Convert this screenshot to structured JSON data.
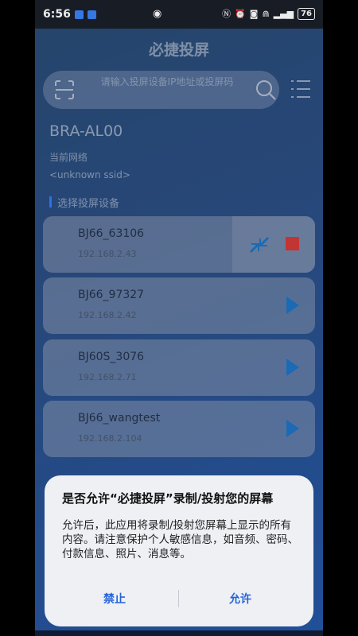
{
  "status_bar": {
    "time": "6:56",
    "battery": "76"
  },
  "app": {
    "title": "必捷投屏",
    "search_placeholder": "请输入投屏设备IP地址或投屏码",
    "device_name": "BRA-AL00",
    "network_label": "当前网络",
    "ssid": "<unknown ssid>",
    "section_label": "选择投屏设备"
  },
  "devices": [
    {
      "name": "BJ66_63106",
      "ip": "192.168.2.43",
      "state": "casting"
    },
    {
      "name": "BJ66_97327",
      "ip": "192.168.2.42",
      "state": "idle"
    },
    {
      "name": "BJ60S_3076",
      "ip": "192.168.2.71",
      "state": "idle"
    },
    {
      "name": "BJ66_wangtest",
      "ip": "192.168.2.104",
      "state": "idle"
    }
  ],
  "dialog": {
    "title": "是否允许“必捷投屏”录制/投射您的屏幕",
    "body": "允许后，此应用将录制/投射您屏幕上显示的所有内容。请注意保护个人敏感信息，如音频、密码、付款信息、照片、消息等。",
    "deny": "禁止",
    "allow": "允许"
  },
  "colors": {
    "accent": "#2563d9",
    "stop": "#d23a3a",
    "play": "#1d73c6"
  }
}
